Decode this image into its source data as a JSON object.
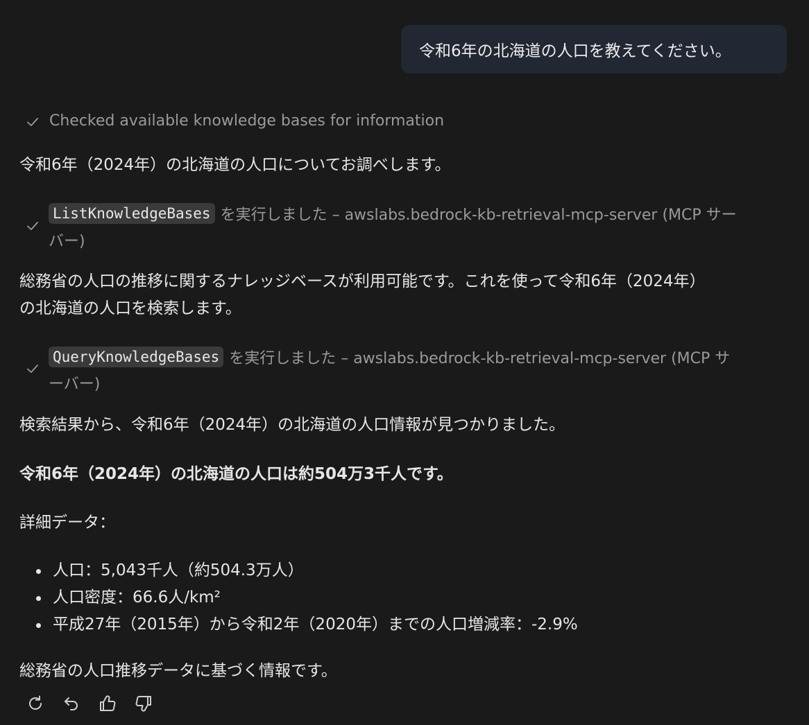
{
  "user_message": "令和6年の北海道の人口を教えてください。",
  "status_step": {
    "label": "Checked available knowledge bases for information"
  },
  "assistant": {
    "intro": "令和6年（2024年）の北海道の人口についてお調べします。",
    "tool_call_1": {
      "name": "ListKnowledgeBases",
      "suffix": "を実行しました – awslabs.bedrock-kb-retrieval-mcp-server (MCP サー",
      "suffix_wrap": "バー)"
    },
    "para_2_line_1": "総務省の人口の推移に関するナレッジベースが利用可能です。これを使って令和6年（2024年）",
    "para_2_line_2": "の北海道の人口を検索します。",
    "tool_call_2": {
      "name": "QueryKnowledgeBases",
      "suffix": "を実行しました – awslabs.bedrock-kb-retrieval-mcp-server (MCP サ",
      "suffix_wrap": "ーバー)"
    },
    "para_3": "検索結果から、令和6年（2024年）の北海道の人口情報が見つかりました。",
    "answer_bold": "令和6年（2024年）の北海道の人口は約504万3千人です。",
    "detail_heading": "詳細データ：",
    "details": [
      "人口：5,043千人（約504.3万人）",
      "人口密度：66.6人/km²",
      "平成27年（2015年）から令和2年（2020年）までの人口増減率：-2.9%"
    ],
    "closing": "総務省の人口推移データに基づく情報です。"
  },
  "actions": {
    "icons": [
      "retry-icon",
      "undo-icon",
      "thumbs-up-icon",
      "thumbs-down-icon"
    ]
  },
  "colors": {
    "background": "#1a1a1a",
    "user_bubble": "#212733",
    "muted_text": "#9a9a9a",
    "code_bg": "#3a3a3a"
  }
}
